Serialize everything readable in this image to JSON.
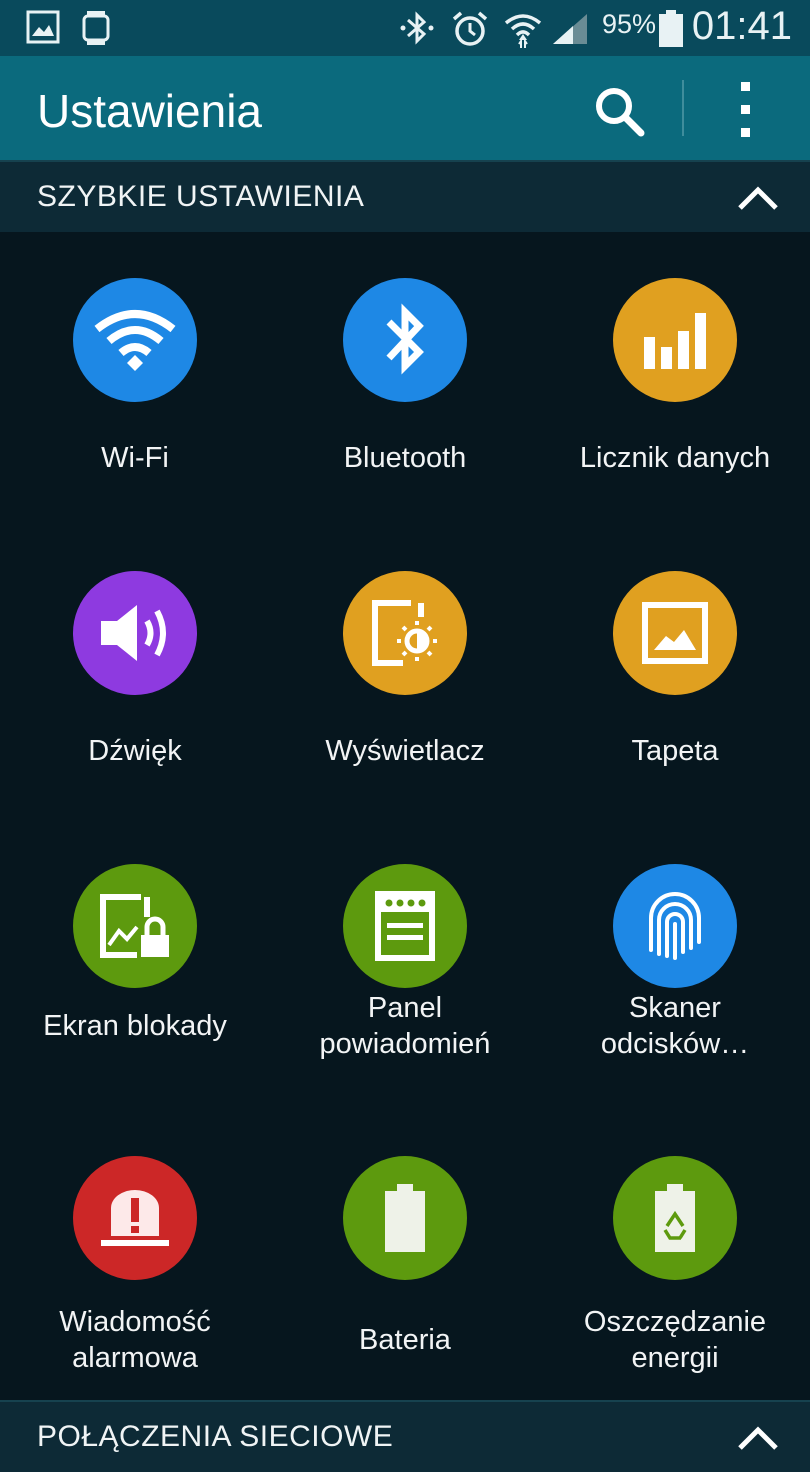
{
  "status_bar": {
    "battery_percent": "95%",
    "time": "01:41",
    "icons": [
      "gallery-notification-icon",
      "watch-notification-icon",
      "bluetooth-icon",
      "alarm-icon",
      "wifi-icon",
      "signal-icon",
      "battery-icon"
    ]
  },
  "app_bar": {
    "title": "Ustawienia",
    "icons": [
      "search-icon",
      "more-options-icon"
    ]
  },
  "quick_settings": {
    "header": "SZYBKIE USTAWIENIA",
    "items": [
      {
        "label": "Wi-Fi",
        "icon": "wifi-icon",
        "color": "#1e88e5"
      },
      {
        "label": "Bluetooth",
        "icon": "bluetooth-icon",
        "color": "#1e88e5"
      },
      {
        "label": "Licznik danych",
        "icon": "data-usage-icon",
        "color": "#e0a020"
      },
      {
        "label": "Dźwięk",
        "icon": "sound-icon",
        "color": "#8e3ae0"
      },
      {
        "label": "Wyświetlacz",
        "icon": "display-icon",
        "color": "#e0a020"
      },
      {
        "label": "Tapeta",
        "icon": "wallpaper-icon",
        "color": "#e0a020"
      },
      {
        "label": "Ekran blokady",
        "icon": "lock-screen-icon",
        "color": "#5d9a0e"
      },
      {
        "label": "Panel\npowiadomień",
        "icon": "notification-panel-icon",
        "color": "#5d9a0e"
      },
      {
        "label": "Skaner\nodcisków…",
        "icon": "fingerprint-icon",
        "color": "#1e88e5"
      },
      {
        "label": "Wiadomość\nalarmowa",
        "icon": "emergency-message-icon",
        "color": "#cc2727"
      },
      {
        "label": "Bateria",
        "icon": "battery-icon",
        "color": "#5d9a0e"
      },
      {
        "label": "Oszczędzanie\nenergii",
        "icon": "power-saving-icon",
        "color": "#5d9a0e"
      }
    ]
  },
  "network_section": {
    "header": "POŁĄCZENIA SIECIOWE"
  }
}
